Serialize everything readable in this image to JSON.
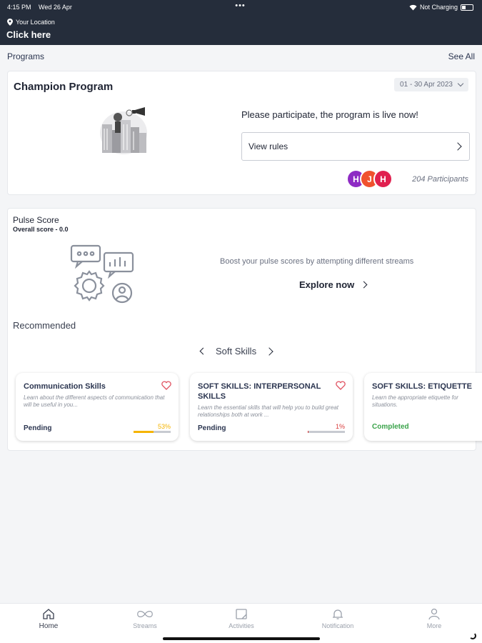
{
  "status_bar": {
    "time": "4:15 PM",
    "date": "Wed 26 Apr",
    "dots": "•••",
    "charging": "Not Charging"
  },
  "header": {
    "location_label": "Your Location",
    "location_value": "Click here"
  },
  "programs": {
    "section_title": "Programs",
    "see_all": "See All",
    "card": {
      "title": "Champion Program",
      "date_range": "01 - 30 Apr 2023",
      "message": "Please participate, the program is live now!",
      "view_rules": "View rules",
      "avatars": [
        {
          "letter": "H",
          "color": "#8e2bc4"
        },
        {
          "letter": "J",
          "color": "#f0512e"
        },
        {
          "letter": "H",
          "color": "#e0204f"
        }
      ],
      "participants": "204 Participants"
    }
  },
  "pulse": {
    "title": "Pulse Score",
    "overall": "Overall score -  0.0",
    "boost_text": "Boost your pulse scores by attempting different streams",
    "explore": "Explore now",
    "recommended": "Recommended",
    "stream_name": "Soft Skills",
    "courses": [
      {
        "title": "Communication Skills",
        "desc": "Learn about the different aspects of communication that will be useful in you...",
        "status": "Pending",
        "percent": "53%",
        "progress": 0.53,
        "color": "#f5b400"
      },
      {
        "title": "SOFT SKILLS: INTERPERSONAL SKILLS",
        "desc": "Learn the essential skills that will help you to build great relationships both at work ...",
        "status": "Pending",
        "percent": "1%",
        "progress": 0.01,
        "color": "#d93b3b"
      },
      {
        "title": "SOFT SKILLS: ETIQUETTE",
        "desc": "Learn the appropriate etiquette for situations.",
        "status": "Completed"
      }
    ]
  },
  "nav": {
    "items": [
      {
        "label": "Home",
        "icon": "home-icon"
      },
      {
        "label": "Streams",
        "icon": "infinity-icon"
      },
      {
        "label": "Activities",
        "icon": "activities-icon"
      },
      {
        "label": "Notification",
        "icon": "bell-icon"
      },
      {
        "label": "More",
        "icon": "user-icon"
      }
    ]
  }
}
